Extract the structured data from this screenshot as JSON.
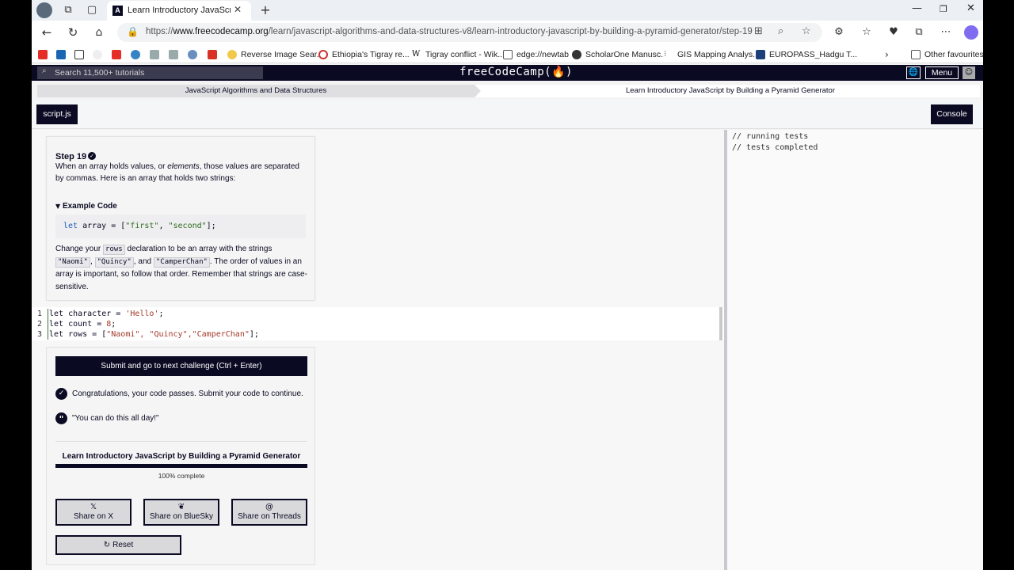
{
  "browser": {
    "tab_title": "Learn Introductory JavaScript by B",
    "url_prefix": "https://",
    "url_domain": "www.freecodecamp.org",
    "url_path": "/learn/javascript-algorithms-and-data-structures-v8/learn-introductory-javascript-by-building-a-pyramid-generator/step-19",
    "bookmarks": [
      "Reverse Image Sear...",
      "Ethiopia's Tigray re...",
      "Tigray conflict - Wik...",
      "edge://newtab",
      "ScholarOne Manusc...",
      "GIS Mapping Analys...",
      "EUROPASS_Hadgu T..."
    ],
    "other_favourites": "Other favourites"
  },
  "header": {
    "search_placeholder": "Search 11,500+ tutorials",
    "logo": "freeCodeCamp(🔥)",
    "menu_label": "Menu"
  },
  "breadcrumb": {
    "superblock": "JavaScript Algorithms and Data Structures",
    "block": "Learn Introductory JavaScript by Building a Pyramid Generator"
  },
  "editor_tabs": {
    "file": "script.js",
    "console_button": "Console"
  },
  "instructions": {
    "step_title": "Step 19",
    "para1_a": "When an array holds values, or ",
    "para1_em": "elements",
    "para1_b": ", those values are separated by commas. Here is an array that holds two strings:",
    "example_heading": "Example Code",
    "example_kw": "let",
    "example_rest": " array = [",
    "example_s1": "\"first\"",
    "example_sep": ", ",
    "example_s2": "\"second\"",
    "example_end": "];",
    "para2_a": "Change your ",
    "para2_code1": "rows",
    "para2_b": " declaration to be an array with the strings ",
    "para2_code2": "\"Naomi\"",
    "para2_c": ", ",
    "para2_code3": "\"Quincy\"",
    "para2_d": ", and ",
    "para2_code4": "\"CamperChan\"",
    "para2_e": ". The order of values in an array is important, so follow that order. Remember that strings are case-sensitive."
  },
  "code": {
    "lines": [
      {
        "num": "1",
        "a": "let character = ",
        "s": "'Hello'",
        "b": ";"
      },
      {
        "num": "2",
        "a": "let count = ",
        "s": "8",
        "b": ";"
      },
      {
        "num": "3",
        "a": "let rows = [",
        "s": "\"Naomi\", \"Quincy\",\"CamperChan\"",
        "b": "];"
      }
    ]
  },
  "console": {
    "output": "// running tests\n// tests completed"
  },
  "results": {
    "submit_label": "Submit and go to next challenge (Ctrl + Enter)",
    "pass_message": "Congratulations, your code passes. Submit your code to continue.",
    "quote": "\"You can do this all day!\"",
    "course_title": "Learn Introductory JavaScript by Building a Pyramid Generator",
    "progress_percent": 100,
    "progress_text": "100% complete",
    "share_x": "Share on X",
    "share_bluesky": "Share on BlueSky",
    "share_threads": "Share on Threads",
    "reset_label": "Reset"
  },
  "colors": {
    "fcc_dark": "#0a0a23",
    "breadcrumb_gray": "#dfdfe2",
    "code_string": "#a33a2a"
  }
}
